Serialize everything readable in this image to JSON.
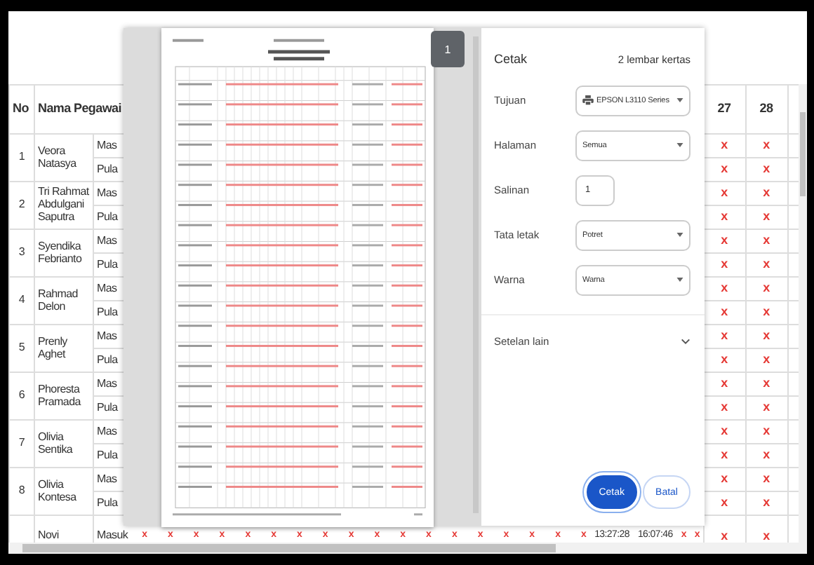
{
  "table": {
    "columns": [
      "No",
      "Nama Pegawai"
    ],
    "day_columns": [
      "27",
      "28"
    ],
    "employees": [
      {
        "no": "1",
        "name": "Veora Natasya",
        "entries": [
          {
            "label": "Mas",
            "day_27": "x",
            "day_28": "x"
          },
          {
            "label": "Pula",
            "day_27": "x",
            "day_28": "x"
          }
        ]
      },
      {
        "no": "2",
        "name": "Tri Rahmat Abdulgani Saputra",
        "entries": [
          {
            "label": "Mas",
            "day_27": "x",
            "day_28": "x"
          },
          {
            "label": "Pula",
            "day_27": "x",
            "day_28": "x"
          }
        ]
      },
      {
        "no": "3",
        "name": "Syendika Febrianto",
        "entries": [
          {
            "label": "Mas",
            "day_27": "x",
            "day_28": "x"
          },
          {
            "label": "Pula",
            "day_27": "x",
            "day_28": "x"
          }
        ]
      },
      {
        "no": "4",
        "name": "Rahmad Delon",
        "entries": [
          {
            "label": "Mas",
            "day_27": "x",
            "day_28": "x"
          },
          {
            "label": "Pula",
            "day_27": "x",
            "day_28": "x"
          }
        ]
      },
      {
        "no": "5",
        "name": "Prenly Aghet",
        "entries": [
          {
            "label": "Mas",
            "day_27": "x",
            "day_28": "x"
          },
          {
            "label": "Pula",
            "day_27": "x",
            "day_28": "x"
          }
        ]
      },
      {
        "no": "6",
        "name": "Phoresta Pramada",
        "entries": [
          {
            "label": "Mas",
            "day_27": "x",
            "day_28": "x"
          },
          {
            "label": "Pula",
            "day_27": "x",
            "day_28": "x"
          }
        ]
      },
      {
        "no": "7",
        "name": "Olivia Sentika",
        "entries": [
          {
            "label": "Mas",
            "day_27": "x",
            "day_28": "x"
          },
          {
            "label": "Pula",
            "day_27": "x",
            "day_28": "x"
          }
        ]
      },
      {
        "no": "8",
        "name": "Olivia Kontesa",
        "entries": [
          {
            "label": "Mas",
            "day_27": "x",
            "day_28": "x"
          },
          {
            "label": "Pula",
            "day_27": "x",
            "day_28": "x"
          }
        ]
      }
    ],
    "partial_row": {
      "name": "Novi",
      "label": "Masuk",
      "middle_marks": [
        "x",
        "x",
        "x",
        "x",
        "x",
        "x",
        "x",
        "x",
        "x",
        "x",
        "x",
        "x",
        "x",
        "x",
        "x",
        "x",
        "x",
        "x"
      ],
      "times": [
        "13:27:28",
        "16:07:46"
      ],
      "end_marks": [
        "x",
        "x"
      ],
      "day_27": "x",
      "day_28": "x"
    }
  },
  "print_dialog": {
    "page_badge": "1",
    "title": "Cetak",
    "sheet_count": "2 lembar kertas",
    "settings": [
      {
        "kind": "printer_select",
        "label": "Tujuan",
        "value": "EPSON L3110 Series"
      },
      {
        "kind": "select",
        "label": "Halaman",
        "value": "Semua"
      },
      {
        "kind": "number",
        "label": "Salinan",
        "value": "1"
      },
      {
        "kind": "select",
        "label": "Tata letak",
        "value": "Potret"
      },
      {
        "kind": "select",
        "label": "Warna",
        "value": "Warna"
      }
    ],
    "more_settings": "Setelan lain",
    "buttons": [
      {
        "label": "Cetak",
        "kind": "primary"
      },
      {
        "label": "Batal",
        "kind": "secondary"
      }
    ]
  }
}
